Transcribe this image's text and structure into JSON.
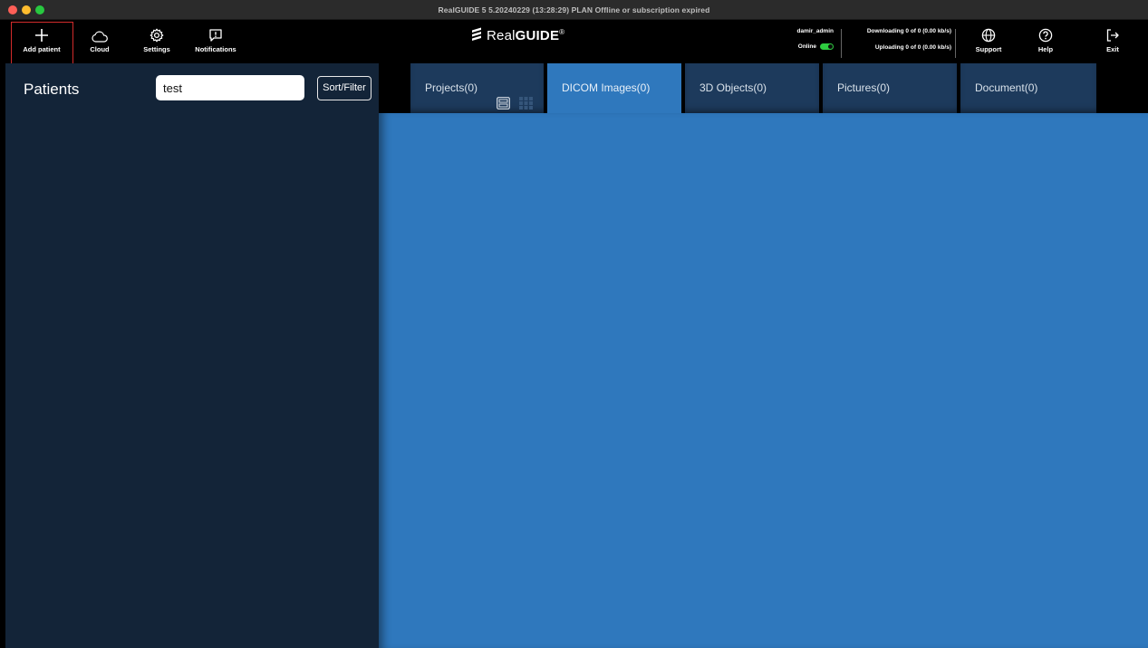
{
  "window": {
    "title": "RealGUIDE 5  5.20240229 (13:28:29)  PLAN Offline or subscription expired"
  },
  "toolbar": {
    "add_patient": "Add patient",
    "cloud": "Cloud",
    "settings": "Settings",
    "notifications": "Notifications",
    "support": "Support",
    "help": "Help",
    "exit": "Exit"
  },
  "brand": {
    "name_light": "Real",
    "name_bold": "GUIDE",
    "reg_mark": "®"
  },
  "status": {
    "username": "damir_admin",
    "online_label": "Online",
    "online": true,
    "downloading": "Downloading 0 of 0 (0.00 kb/s)",
    "uploading": "Uploading 0 of 0 (0.00 kb/s)"
  },
  "patients": {
    "title": "Patients",
    "search_value": "test",
    "sort_filter_label": "Sort/Filter"
  },
  "tabs": [
    {
      "label": "Projects(0)",
      "active": false
    },
    {
      "label": "DICOM Images(0)",
      "active": true
    },
    {
      "label": "3D Objects(0)",
      "active": false
    },
    {
      "label": "Pictures(0)",
      "active": false
    },
    {
      "label": "Document(0)",
      "active": false
    }
  ],
  "colors": {
    "accent_blue": "#2f78bd",
    "panel_navy": "#132438",
    "tab_inactive": "#1d3a5c",
    "online_green": "#2ecc40",
    "highlight_red": "#d32b2b"
  }
}
